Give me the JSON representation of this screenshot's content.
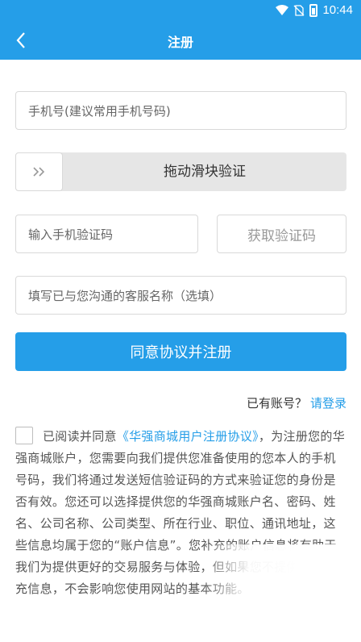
{
  "status": {
    "time": "10:44"
  },
  "header": {
    "title": "注册",
    "back_icon": "chevron-left-icon"
  },
  "form": {
    "phone_placeholder": "手机号(建议常用手机号码)",
    "slider_label": "拖动滑块验证",
    "slider_handle_icon": "double-chevron-right-icon",
    "code_placeholder": "输入手机验证码",
    "get_code_label": "获取验证码",
    "service_placeholder": "填写已与您沟通的客服名称（选填）",
    "submit_label": "同意协议并注册"
  },
  "login_prompt": {
    "text": "已有账号？",
    "link": "请登录"
  },
  "agreement": {
    "prefix": "已阅读并同意",
    "link": "《华强商城用户注册协议》",
    "body": "，为注册您的华强商城账户，您需要向我们提供您准备使用的您本人的手机号码，我们将通过发送短信验证码的方式来验证您的身份是否有效。您还可以选择提供您的华强商城账户名、密码、姓名、公司名称、公司类型、所在行业、职位、通讯地址，这些信息均属于您的“账户信息”。您补充的账户信息将有助于我们为提供更好的交易服务与体验，但如果您不提供这些补充信息，不会影响您使用网站的基本功能。"
  },
  "colors": {
    "accent": "#259ee8"
  }
}
